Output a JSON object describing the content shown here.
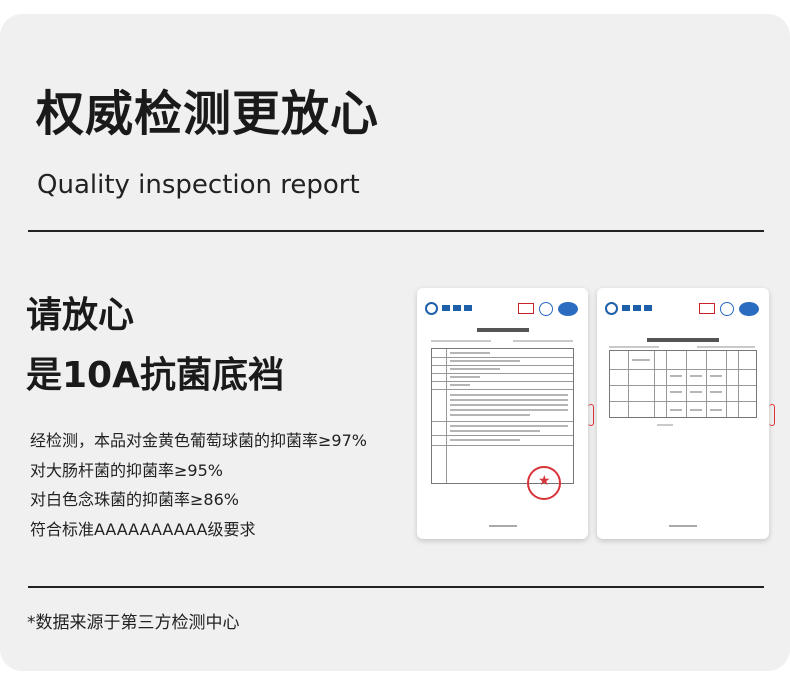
{
  "header": {
    "title": "权威检测更放心",
    "subtitle": "Quality inspection report"
  },
  "feature": {
    "heading_line1": "请放心",
    "heading_line2": "是10A抗菌底裆"
  },
  "points": [
    "经检测，本品对金黄色葡萄球菌的抑菌率≥97%",
    "对大肠杆菌的抑菌率≥95%",
    "对白色念珠菌的抑菌率≥86%",
    "符合标准AAAAAAAAAA级要求"
  ],
  "footnote": "*数据来源于第三方检测中心",
  "colors": {
    "background": "#f0f0f0",
    "text": "#1a1a1a",
    "logo_blue": "#1d5fa8",
    "stamp_red": "#d9333a"
  }
}
